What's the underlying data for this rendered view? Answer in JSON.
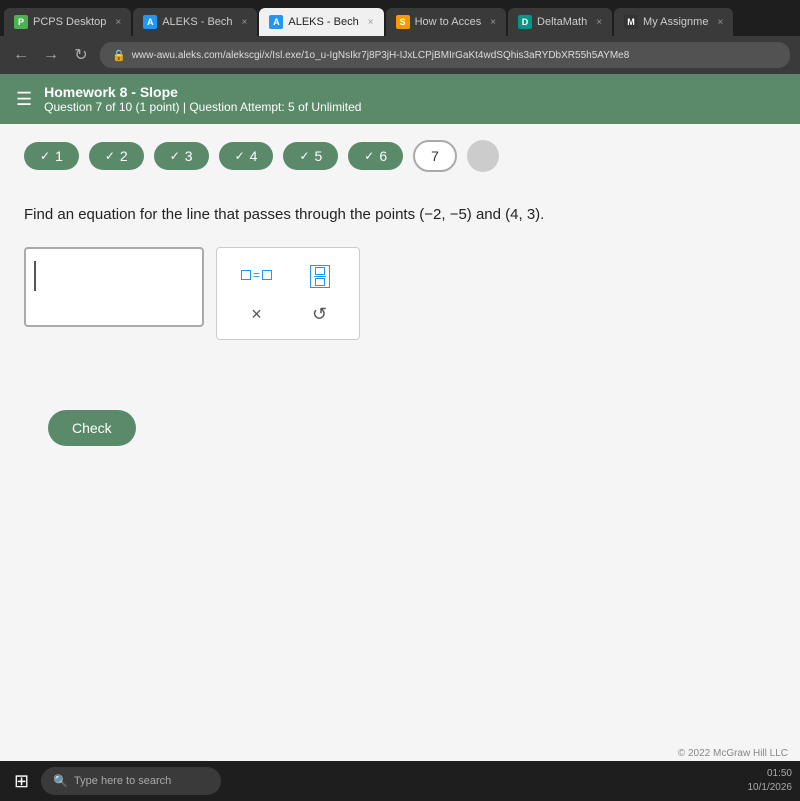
{
  "browser": {
    "tabs": [
      {
        "id": "tab1",
        "icon_type": "green",
        "icon_label": "P",
        "label": "PCPS Desktop",
        "active": false,
        "show_close": true
      },
      {
        "id": "tab2",
        "icon_type": "blue-a",
        "icon_label": "A",
        "label": "ALEKS - Bech",
        "active": false,
        "show_close": true
      },
      {
        "id": "tab3",
        "icon_type": "blue-a",
        "icon_label": "A",
        "label": "ALEKS - Bech",
        "active": false,
        "show_close": true
      },
      {
        "id": "tab4",
        "icon_type": "orange",
        "icon_label": "S",
        "label": "How to Acces",
        "active": false,
        "show_close": true
      },
      {
        "id": "tab5",
        "icon_type": "teal",
        "icon_label": "D",
        "label": "DeltaMath",
        "active": false,
        "show_close": true
      },
      {
        "id": "tab6",
        "icon_type": "dark",
        "icon_label": "M",
        "label": "My Assignme",
        "active": false,
        "show_close": true
      }
    ],
    "address": "www-awu.aleks.com/alekscgi/x/Isl.exe/1o_u-IgNsIkr7j8P3jH-IJxLCPjBMIrGaKt4wdSQhis3aRYDbXR55h5AYMe8"
  },
  "header": {
    "title": "Homework 8 - Slope",
    "subtitle": "Question 7 of 10 (1 point)  |  Question Attempt: 5 of Unlimited"
  },
  "progress": {
    "pills": [
      {
        "num": "1",
        "completed": true
      },
      {
        "num": "2",
        "completed": true
      },
      {
        "num": "3",
        "completed": true
      },
      {
        "num": "4",
        "completed": true
      },
      {
        "num": "5",
        "completed": true
      },
      {
        "num": "6",
        "completed": true
      },
      {
        "num": "7",
        "completed": false,
        "current": true
      }
    ],
    "more": "..."
  },
  "question": {
    "text": "Find an equation for the line that passes through the points (−2, −5) and (4, 3)."
  },
  "math_tools": {
    "equals_symbol": "□=□",
    "fraction_label": "fraction",
    "x_symbol": "×",
    "undo_symbol": "↺"
  },
  "buttons": {
    "check": "Check"
  },
  "taskbar": {
    "search_placeholder": "Type here to search"
  },
  "footer": {
    "copyright": "© 2022 McGraw Hill LLC"
  },
  "colors": {
    "header_bg": "#5a8a6a",
    "pill_completed": "#5a8a6a",
    "check_btn": "#5a8a6a",
    "math_tool_color": "#2196F3"
  }
}
